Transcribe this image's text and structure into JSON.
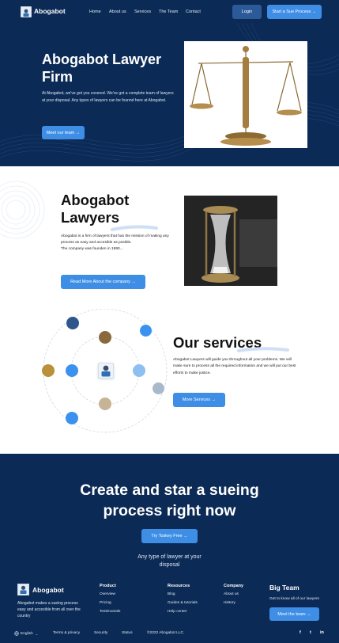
{
  "colors": {
    "navy": "#0b2a55",
    "accent": "#3f8ee6",
    "login": "#2c5a98",
    "white": "#ffffff"
  },
  "nav": {
    "logo_icon": "lawyer-avatar-icon",
    "brand": "Abogabot",
    "links": [
      "Home",
      "About us",
      "Services",
      "The Team",
      "Contact"
    ],
    "login": "Login",
    "start": "Start a Sue Process",
    "start_arrow": "→"
  },
  "hero": {
    "title": "Abogabot Lawyer Firm",
    "body": "At Abogabot, we've got you covered. We've got a complete team of lawyers at your disposal. Any types of lawyers can be founnd here at Abogabot.",
    "button": "Meet our team",
    "button_arrow": "→",
    "image_icon": "scales-of-justice-icon"
  },
  "about": {
    "title_line1": "Abogabot",
    "title_line2": "Lawyers",
    "body_line1": "Abogabot is a firm of lawyers that has the mission of making any process as easy and accesible as posible.",
    "body_line2": "The company was founden in 1990...",
    "button": "Read More About the company",
    "button_arrow": "→",
    "image_icon": "hourglass-icon"
  },
  "services": {
    "title": "Our services",
    "body": "Abogabot Lawyers will guide you throughout all your problems. We will make sure to process all the required information and we will put our best efforts to make justice.",
    "button": "More Services",
    "button_arrow": "→",
    "center_icon": "lawyer-avatar-icon"
  },
  "cta": {
    "title_line1": "Create and star a sueing",
    "title_line2": "process right now",
    "button": "Try Toskey Free",
    "button_arrow": "→",
    "sub_line1": "Any type of lawyer at your",
    "sub_line2": "disposal"
  },
  "footer": {
    "brand": "Abogabot",
    "desc": "Abogabot makes a sueing process easy and accesible from all over the country",
    "product": {
      "title": "Product",
      "links": [
        "Overview",
        "Pricing",
        "Testimonials"
      ]
    },
    "resources": {
      "title": "Resources",
      "links": [
        "Blog",
        "Guides & tutorials",
        "Help center"
      ]
    },
    "company": {
      "title": "Company",
      "links": [
        "About us",
        "History"
      ]
    },
    "team": {
      "title": "Big Team",
      "sub": "Get to know all of our lawyers",
      "button": "Meet the team",
      "button_arrow": "→"
    },
    "bottom": {
      "language": "English",
      "language_icon": "globe-icon",
      "terms": "Terms & privacy",
      "security": "Security",
      "status": "Status",
      "copyright": "©2022 Abogabot LLC."
    },
    "social": {
      "facebook": "f",
      "twitter": "t",
      "linkedin": "in"
    }
  }
}
